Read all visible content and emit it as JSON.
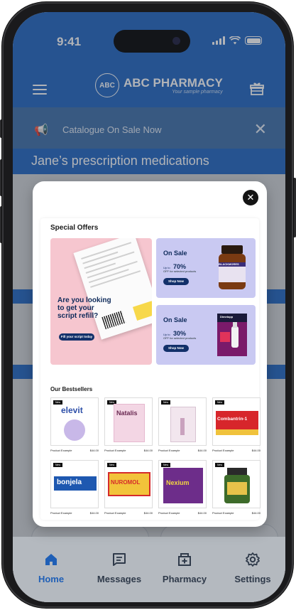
{
  "status_bar": {
    "time": "9:41"
  },
  "app_header": {
    "brand": "ABC PHARMACY",
    "tagline": "Your sample pharmacy",
    "logo_glyph": "ABC"
  },
  "banner": {
    "text": "Catalogue On Sale Now",
    "close_glyph": "✕"
  },
  "page_title": "Jane’s prescription medications",
  "modal": {
    "close_glyph": "✕",
    "special_offers_title": "Special Offers",
    "promo_main": {
      "headline": "Are you looking to get your script refill?",
      "button": "Fill your script today"
    },
    "promo_1": {
      "title": "On Sale",
      "upto": "Up to",
      "percent": "70%",
      "subtitle": "OFF for selected products",
      "button": "Shop Now",
      "brand": "BLACKMORES"
    },
    "promo_2": {
      "title": "On Sale",
      "upto": "Up to",
      "percent": "30%",
      "subtitle": "OFF for selected products",
      "button": "Shop Now",
      "brand": "Dimetapp"
    },
    "bestsellers_title": "Our Bestsellers",
    "products": [
      {
        "name": "Product Example",
        "price": "$44.00",
        "badge": "New",
        "brand": "elevit"
      },
      {
        "name": "Product Example",
        "price": "$44.00",
        "badge": "New",
        "brand": "Natalis"
      },
      {
        "name": "Product Example",
        "price": "$44.00",
        "badge": "New",
        "brand": ""
      },
      {
        "name": "Product Example",
        "price": "$44.00",
        "badge": "New",
        "brand": "Combantrin-1"
      },
      {
        "name": "Product Example",
        "price": "$44.00",
        "badge": "New",
        "brand": "bonjela"
      },
      {
        "name": "Product Example",
        "price": "$44.00",
        "badge": "New",
        "brand": "NUROMOL"
      },
      {
        "name": "Product Example",
        "price": "$44.00",
        "badge": "New",
        "brand": "Nexium"
      },
      {
        "name": "Product Example",
        "price": "$44.00",
        "badge": "New",
        "brand": ""
      }
    ]
  },
  "tabbar": {
    "items": [
      {
        "label": "Home",
        "icon": "home-icon"
      },
      {
        "label": "Messages",
        "icon": "message-icon"
      },
      {
        "label": "Pharmacy",
        "icon": "pharmacy-icon"
      },
      {
        "label": "Settings",
        "icon": "settings-icon"
      }
    ]
  },
  "colors": {
    "primary": "#1f65c0",
    "banner": "#3d6ea9",
    "active_tab": "#1f5fb6",
    "promo_pink": "#f6c6cf",
    "promo_lilac": "#c9c9f2",
    "button_navy": "#12306a"
  }
}
